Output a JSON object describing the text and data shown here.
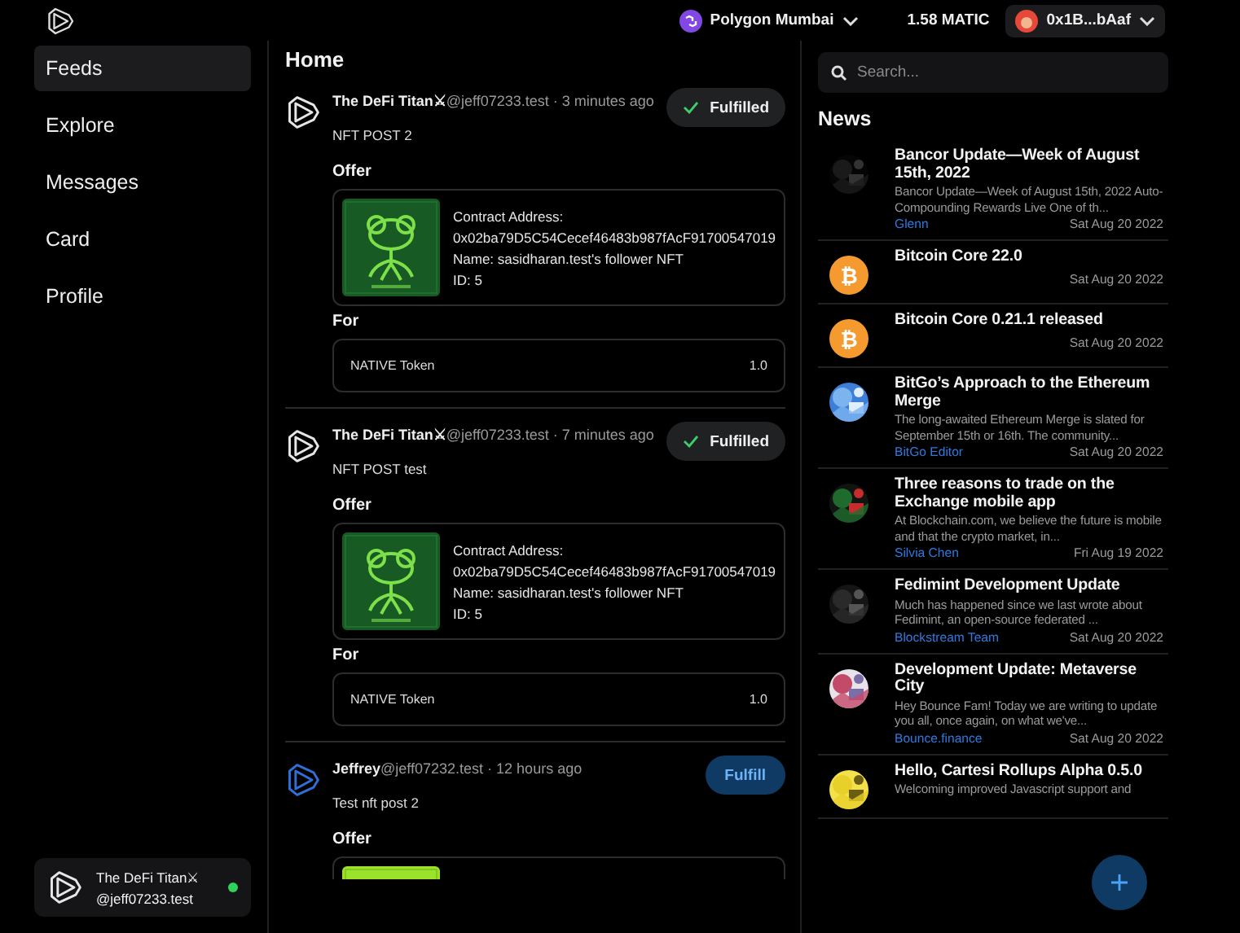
{
  "top_bar": {
    "network": "Polygon Mumbai",
    "balance": "1.58 MATIC",
    "account": "0x1B...bAaf"
  },
  "nav": [
    {
      "label": "Feeds",
      "selected": true
    },
    {
      "label": "Explore",
      "selected": false
    },
    {
      "label": "Messages",
      "selected": false
    },
    {
      "label": "Card",
      "selected": false
    },
    {
      "label": "Profile",
      "selected": false
    }
  ],
  "profile": {
    "name": "The DeFi Titan⚔",
    "handle": "@jeff07233.test",
    "online": true
  },
  "feed": {
    "title": "Home",
    "posts": [
      {
        "name": "The DeFi Titan⚔",
        "meta": "@jeff07233.test · 3 minutes ago",
        "color": "#e6e6e6",
        "status": "Fulfilled",
        "fulfilled": true,
        "text": "NFT POST 2",
        "offer_label": "Offer",
        "offer": {
          "kind": "picture",
          "lines": [
            "Contract Address:",
            "0x02ba79D5C54Cecef46483b987fAcF91700547019",
            "Name: sasidharan.test's follower NFT",
            "ID: 5"
          ]
        },
        "for_label": "For",
        "for": {
          "token": "NATIVE Token",
          "amount": "1.0"
        }
      },
      {
        "name": "The DeFi Titan⚔",
        "meta": "@jeff07233.test · 7 minutes ago",
        "color": "#e6e6e6",
        "status": "Fulfilled",
        "fulfilled": true,
        "text": "NFT POST test",
        "offer_label": "Offer",
        "offer": {
          "kind": "picture",
          "lines": [
            "Contract Address:",
            "0x02ba79D5C54Cecef46483b987fAcF91700547019",
            "Name: sasidharan.test's follower NFT",
            "ID: 5"
          ]
        },
        "for_label": "For",
        "for": {
          "token": "NATIVE Token",
          "amount": "1.0"
        }
      },
      {
        "name": "Jeffrey",
        "meta": "@jeff07232.test · 12 hours ago",
        "color": "#2f6fd6",
        "status": "Fulfill",
        "fulfilled": false,
        "text": "Test nft post 2",
        "offer_label": "Offer"
      }
    ]
  },
  "news": {
    "search": {
      "placeholder": "Search..."
    },
    "title": "News",
    "items": [
      {
        "title": "Bancor Update—Week of August 15th, 2022",
        "description": "Bancor Update—Week of August 15th, 2022 Auto-Compounding Rewards Live One of th...",
        "author": "Glenn",
        "date": "Sat Aug 20 2022"
      },
      {
        "thumb": {
          "kind": "coin",
          "glyph": "₿"
        },
        "title": "Bitcoin Core 22.0",
        "date": "Sat Aug 20 2022"
      },
      {
        "thumb": {
          "kind": "coin",
          "glyph": "₿"
        },
        "title": "Bitcoin Core 0.21.1 released",
        "date": "Sat Aug 20 2022"
      },
      {
        "title": "BitGo’s Approach to the Ethereum Merge",
        "description": "The long-awaited Ethereum Merge is slated for September 15th or 16th. The community...",
        "author": "BitGo Editor",
        "date": "Sat Aug 20 2022"
      },
      {
        "title": "Three reasons to trade on the Exchange mobile app",
        "description": "At Blockchain.com, we believe the future is mobile and that the crypto market, in...",
        "author": "Silvia Chen",
        "date": "Fri Aug 19 2022"
      },
      {
        "title": "Fedimint Development Update",
        "description": "Much has happened since we last wrote about Fedimint, an open-source federated ...",
        "author": "Blockstream Team",
        "date": "Sat Aug 20 2022"
      },
      {
        "title": "Development Update: Metaverse City",
        "description": "Hey Bounce Fam! Today we are writing to update you all, once again, on what we've...",
        "author": "Bounce.finance",
        "date": "Sat Aug 20 2022"
      },
      {
        "title": "Hello, Cartesi Rollups Alpha 0.5.0",
        "description": "Welcoming improved Javascript support and"
      }
    ]
  }
}
